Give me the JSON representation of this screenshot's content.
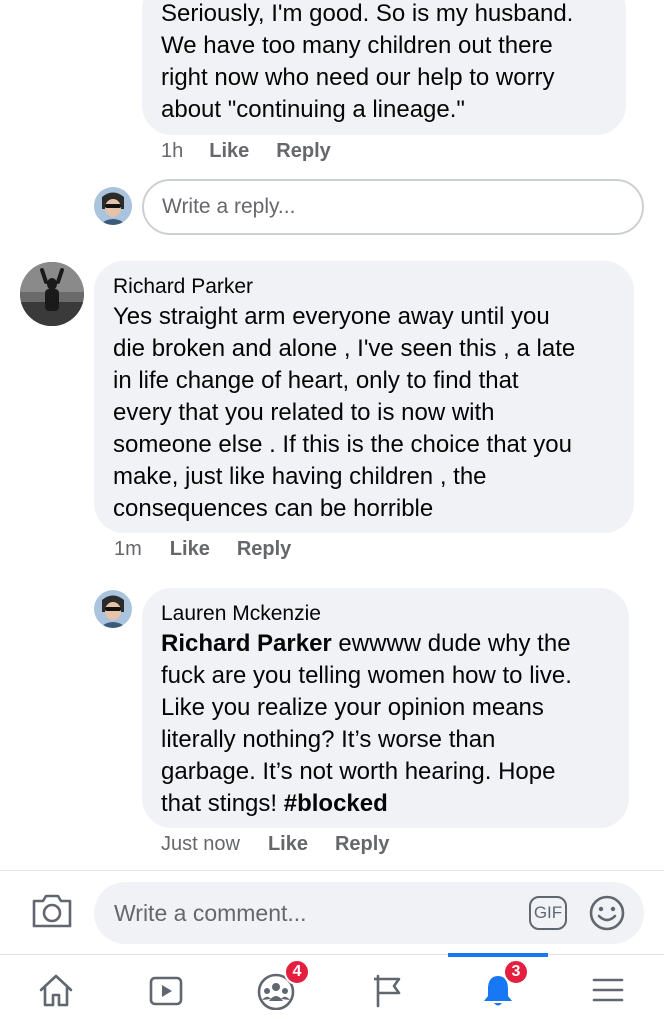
{
  "comment1": {
    "text": "Seriously, I'm good. So is my husband.\nWe have too many children out there\nright now who need our help to worry\nabout \"continuing a lineage.\"",
    "time": "1h",
    "like": "Like",
    "reply": "Reply"
  },
  "reply_box": {
    "placeholder": "Write a reply..."
  },
  "comment2": {
    "author": "Richard Parker",
    "text": "Yes straight arm everyone away until you\ndie broken and alone , I've seen this , a late\nin life change of heart,  only to find that\nevery that you related to is now with\nsomeone else . If this is the choice that you\nmake,  just like having children , the\nconsequences can be horrible",
    "time": "1m",
    "like": "Like",
    "reply": "Reply"
  },
  "comment3": {
    "author": "Lauren Mckenzie",
    "mention": "Richard Parker",
    "text_line1": " ewwww dude why the",
    "text_body": "fuck are you telling women how to live.\nLike you realize your opinion means\nliterally nothing? It’s worse than\ngarbage. It’s not worth hearing. Hope\nthat stings! ",
    "hashtag": "#blocked",
    "time": "Just now",
    "like": "Like",
    "reply": "Reply"
  },
  "composer": {
    "placeholder": "Write a comment...",
    "gif_label": "GIF"
  },
  "tabbar": {
    "groups_badge": "4",
    "notifications_badge": "3"
  },
  "colors": {
    "accent": "#1877f2",
    "badge": "#e41e3f",
    "bubble": "#f0f2f5",
    "meta": "#65676b"
  }
}
